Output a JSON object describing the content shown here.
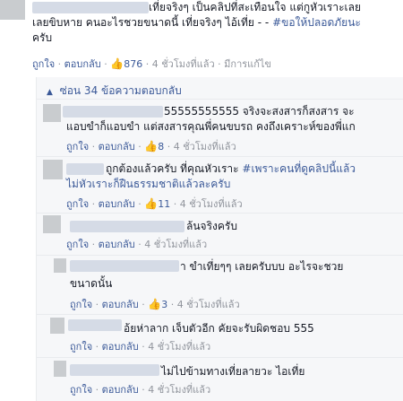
{
  "top_comment": {
    "line1": "เที่ยจริงๆ เป็นคลิปที่สะเทือนใจ แต่กูหัวเราะเลย",
    "line2_text": "เลยขิบหาย คนอะไรชวยขนาดนี้ เที่ยจริงๆ ไอ้เที่ย - - ",
    "line2_tag": "#ขอให้ปลอดภัยนะ",
    "line3": "ครับ",
    "like": "ถูกใจ",
    "reply": "ตอบกลับ",
    "like_count": "876",
    "time": "4 ชั่วโมงที่แล้ว",
    "edited": "มีการแก้ไข"
  },
  "hidden_replies": "ซ่อน 34 ข้อความตอบกลับ",
  "replies": [
    {
      "line1": "55555555555 จริงจะสงสารก็สงสาร จะ",
      "line2": "แอบขำก็แอบขำ แต่สงสารคุณพี่คนขบรถ คงถึงเคราะห์ของพี่แก",
      "like_count": "8"
    },
    {
      "line1_text": "ถูกต้องแล้วครับ ที่คุณหัวเราะ ",
      "line1_tag": "#เพราะคนที่ดูคลิปนี้แล้ว",
      "line2_tag": "ไม่หัวเราะก็ฝืนธรรมชาติแล้วละครับ",
      "like_count": "11"
    },
    {
      "line1": "ล้นจริงครับ"
    },
    {
      "line1": "า ขำเที่ยๆๆ เลยครับบบ อะไรจะชวย",
      "line2": "ขนาดนั้น",
      "like_count": "3"
    },
    {
      "line1": "อ้ยห่าลาก เจ็บตัวอีก คัยจะรับผิดชอบ 555"
    },
    {
      "line1": "ไม่ไปข้ามทางเที่ยลายวะ ไอเที่ย"
    }
  ],
  "labels": {
    "like": "ถูกใจ",
    "reply": "ตอบกลับ",
    "time": "4 ชั่วโมงที่แล้ว",
    "dot": "·",
    "like_icon": "👍"
  }
}
